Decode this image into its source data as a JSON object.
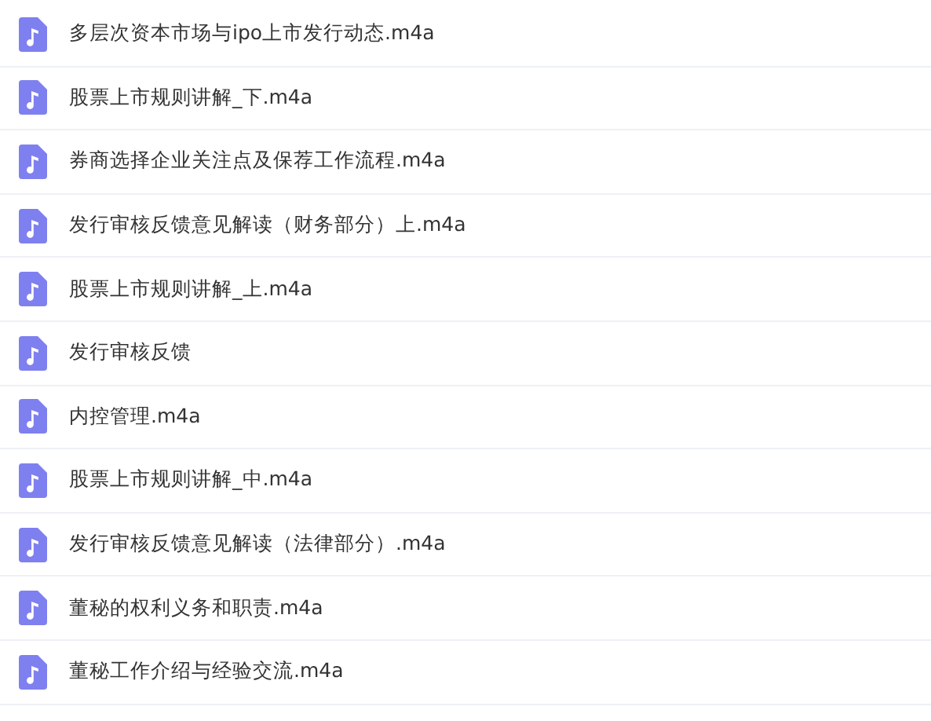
{
  "files": [
    {
      "name": "多层次资本市场与ipo上市发行动态.m4a"
    },
    {
      "name": "股票上市规则讲解_下.m4a"
    },
    {
      "name": "券商选择企业关注点及保荐工作流程.m4a"
    },
    {
      "name": "发行审核反馈意见解读（财务部分）上.m4a"
    },
    {
      "name": "股票上市规则讲解_上.m4a"
    },
    {
      "name": "发行审核反馈"
    },
    {
      "name": "内控管理.m4a"
    },
    {
      "name": "股票上市规则讲解_中.m4a"
    },
    {
      "name": "发行审核反馈意见解读（法律部分）.m4a"
    },
    {
      "name": "董秘的权利义务和职责.m4a"
    },
    {
      "name": "董秘工作介绍与经验交流.m4a"
    }
  ]
}
